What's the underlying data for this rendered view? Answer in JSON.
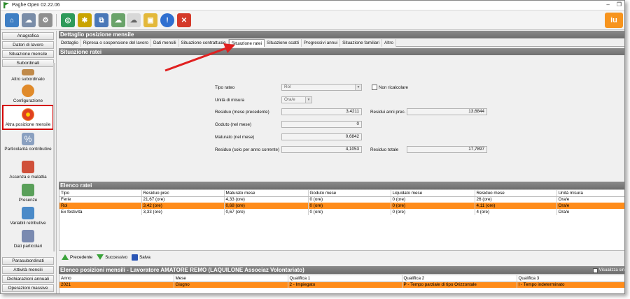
{
  "window": {
    "title": "Paghe Open 02.22.06",
    "min": "–",
    "restore": "❐"
  },
  "toolbar": {
    "icons": [
      "home-icon",
      "cloud-sync-icon",
      "tools-icon",
      "world-icon",
      "bug-icon",
      "network-icon",
      "cloud-icon",
      "folder-icon",
      "info-icon",
      "close-icon"
    ],
    "brand": "iu"
  },
  "sidebar": {
    "top_buttons": [
      "Anagrafica",
      "Datori di lavoro",
      "Situazione mensile",
      "Subordinati"
    ],
    "items": [
      "Altro subordinato",
      "Configurazione",
      "Altra posizione mensile",
      "Particolarità contributive",
      "Assenza e malattia",
      "Presenze",
      "Variabili retributive",
      "Dati particolari"
    ],
    "bottom_buttons": [
      "Parasubordinati",
      "Attività mensili",
      "Dichiarazioni annuali",
      "Operazioni massive"
    ]
  },
  "detail": {
    "header": "Dettaglio posizione mensile",
    "tabs": [
      "Dettaglio",
      "Ripresa o sospensione del lavoro",
      "Dati mensili",
      "Situazione contrattuale",
      "Situazione ratei",
      "Situazione scatti",
      "Progressivi annui",
      "Situazione familiari",
      "Altro"
    ],
    "active_tab": "Situazione ratei"
  },
  "ratei": {
    "header": "Situazione ratei",
    "tipo_rateo_label": "Tipo rateo",
    "tipo_rateo_value": "Rol",
    "non_ricalcolare_label": "Non ricalcolare",
    "unita_label": "Unità di misura",
    "unita_value": "Ora/e",
    "residuo_prec_label": "Residuo (mese precedente)",
    "residuo_prec_value": "3,4211",
    "residui_anni_label": "Residui anni prec.",
    "residui_anni_value": "13,6844",
    "goduto_label": "Goduto (nel mese)",
    "goduto_value": "0",
    "maturato_label": "Maturato (nel mese)",
    "maturato_value": "0,6842",
    "residuo_anno_label": "Residuo (solo per anno corrente)",
    "residuo_anno_value": "4,1053",
    "residuo_tot_label": "Residuo totale",
    "residuo_tot_value": "17,7897"
  },
  "elenco": {
    "header": "Elenco ratei",
    "columns": [
      "Tipo",
      "Residuo prec",
      "Maturato mese",
      "Goduto mese",
      "Liquidato mese",
      "Residuo mese",
      "Unità misura"
    ],
    "rows": [
      [
        "Ferie",
        "21,67 (ore)",
        "4,33 (ore)",
        "0 (ore)",
        "0 (ore)",
        "26 (ore)",
        "Ora/e"
      ],
      [
        "Rol",
        "3,42 (ore)",
        "0,68 (ore)",
        "0 (ore)",
        "0 (ore)",
        "4,11 (ore)",
        "Ora/e"
      ],
      [
        "Ex festività",
        "3,33 (ore)",
        "0,67 (ore)",
        "0 (ore)",
        "0 (ore)",
        "4 (ore)",
        "Ora/e"
      ]
    ],
    "selected_row": 1
  },
  "nav": {
    "prev": "Precedente",
    "next": "Successivo",
    "save": "Salva"
  },
  "posizioni": {
    "header": "Elenco posizioni mensili - Lavoratore AMATORE REMO (LAQUILONE Associaz Volontariato)",
    "visualizza": "Visualizza sin",
    "columns": [
      "Anno",
      "Mese",
      "Qualifica 1",
      "Qualifica 2",
      "Qualifica 3"
    ],
    "rows": [
      [
        "2021",
        "Giugno",
        "2 - Impiegato",
        "P - Tempo parziale di tipo Orizzontale",
        "I - Tempo indeterminato"
      ]
    ]
  },
  "colors": {
    "selected_row": "#ff8c1a",
    "header_bg": "#7a7a7a",
    "highlight_border": "#d40000",
    "arrow": "#e02020"
  }
}
